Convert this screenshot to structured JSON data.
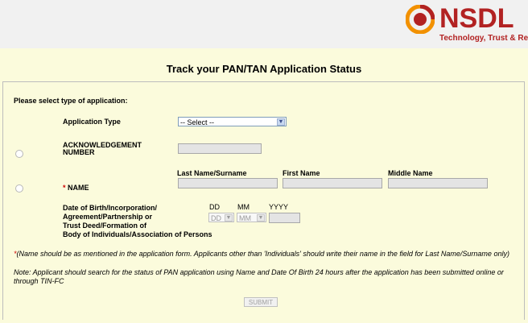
{
  "header": {
    "logo_text": "NSDL",
    "logo_tagline": "Technology, Trust & Reach"
  },
  "page_title": "Track your PAN/TAN Application Status",
  "form": {
    "select_type_label": "Please select type of application:",
    "application_type_label": "Application Type",
    "application_type_value": "-- Select --",
    "ack_label_line1": "ACKNOWLEDGEMENT",
    "ack_label_line2": "NUMBER",
    "name_label": "NAME",
    "name_required_mark": "*",
    "last_name_label": "Last Name/Surname",
    "first_name_label": "First Name",
    "middle_name_label": "Middle Name",
    "dob_label_lines": [
      "Date of Birth/Incorporation/",
      "Agreement/Partnership or",
      "Trust Deed/Formation of",
      "Body of Individuals/Association of Persons"
    ],
    "dd_label": "DD",
    "mm_label": "MM",
    "yyyy_label": "YYYY",
    "dd_value": "DD",
    "mm_value": "MM",
    "note_star": "*",
    "note_name": "(Name should be as mentioned in the application form. Applicants other than 'Individuals' should write their name in the field for Last Name/Surname only)",
    "note_applicant_line1": "Note: Applicant should search for the status of PAN application using Name and Date Of Birth 24 hours after the application has been submitted online or",
    "note_applicant_line2": "through TIN-FC",
    "submit_label": "SUBMIT"
  },
  "colors": {
    "background": "#fbfbdc",
    "header_bg": "#f1f1f1",
    "brand_red": "#b22222",
    "brand_orange": "#f29100"
  }
}
